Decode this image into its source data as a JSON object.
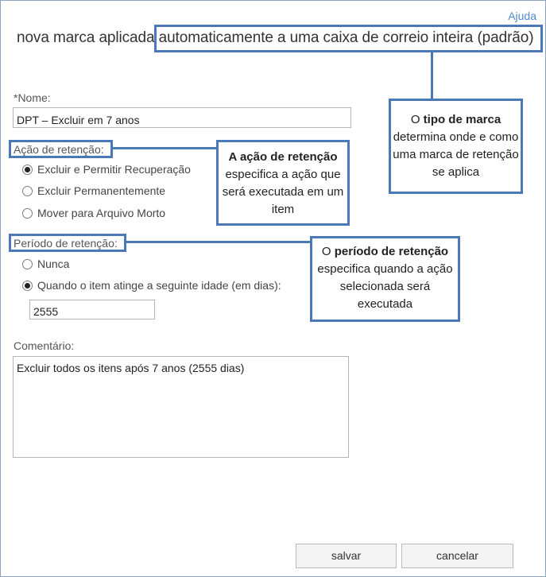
{
  "header": {
    "help_label": "Ajuda",
    "title_prefix": "nova marca aplicada ",
    "title_highlight": "automaticamente a uma caixa de correio inteira (padrão)"
  },
  "form": {
    "name_label": "*Nome:",
    "name_value": "DPT – Excluir em 7 anos",
    "retention_action_label": "Ação de retenção:",
    "retention_action_options": [
      {
        "label": "Excluir e Permitir Recuperação",
        "selected": true
      },
      {
        "label": "Excluir Permanentemente",
        "selected": false
      },
      {
        "label": "Mover para Arquivo Morto",
        "selected": false
      }
    ],
    "retention_period_label": "Período de retenção:",
    "retention_period_options": [
      {
        "label": "Nunca",
        "selected": false
      },
      {
        "label": "Quando o item atinge a seguinte idade (em dias):",
        "selected": true
      }
    ],
    "age_days_value": "2555",
    "comment_label": "Comentário:",
    "comment_value": "Excluir todos os itens após 7 anos (2555 dias)"
  },
  "callouts": {
    "tag_type": {
      "prefix": "O ",
      "bold": "tipo de marca",
      "rest": "determina onde e como uma marca de retenção se aplica"
    },
    "retention_action": {
      "bold": "A ação de retenção",
      "rest": "especifica a ação que será executada em um item"
    },
    "retention_period": {
      "prefix": "O ",
      "bold": "período de retenção",
      "rest": "especifica quando a ação selecionada será executada"
    }
  },
  "buttons": {
    "save_label": "salvar",
    "cancel_label": "cancelar"
  },
  "colors": {
    "callout_border": "#4a78b8",
    "help_link": "#4f8ad0"
  }
}
